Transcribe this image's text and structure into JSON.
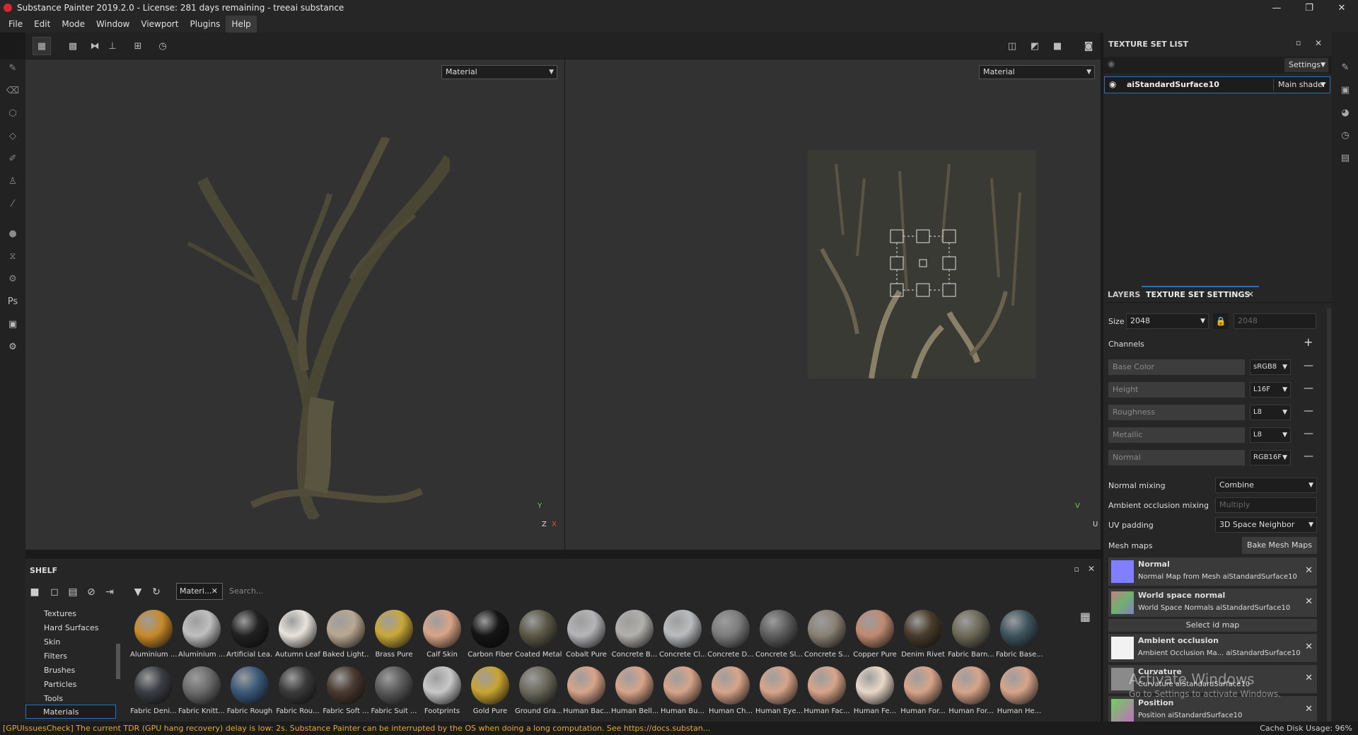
{
  "window": {
    "title": "Substance Painter 2019.2.0 - License: 281 days remaining - treeai substance",
    "minimize": "—",
    "maximize": "❐",
    "close": "✕"
  },
  "menu": [
    "File",
    "Edit",
    "Mode",
    "Window",
    "Viewport",
    "Plugins",
    "Help"
  ],
  "viewport_3d": {
    "mode": "Material",
    "axis_y": "Y",
    "axis_z": "Z",
    "axis_x": "X"
  },
  "viewport_2d": {
    "mode": "Material",
    "axis_v": "V",
    "axis_u": "U"
  },
  "texture_set_list": {
    "title": "TEXTURE SET LIST",
    "settings_label": "Settings",
    "item_name": "aiStandardSurface10",
    "shader": "Main shader"
  },
  "tabs": {
    "layers": "LAYERS",
    "texture_set_settings": "TEXTURE SET SETTINGS"
  },
  "settings": {
    "size_label": "Size",
    "size_value": "2048",
    "size_linked": "2048",
    "channels_label": "Channels",
    "channels": [
      {
        "name": "Base Color",
        "format": "sRGB8"
      },
      {
        "name": "Height",
        "format": "L16F"
      },
      {
        "name": "Roughness",
        "format": "L8"
      },
      {
        "name": "Metallic",
        "format": "L8"
      },
      {
        "name": "Normal",
        "format": "RGB16F"
      }
    ],
    "normal_mixing_label": "Normal mixing",
    "normal_mixing": "Combine",
    "ao_mixing_label": "Ambient occlusion mixing",
    "ao_mixing": "Multiply",
    "uv_padding_label": "UV padding",
    "uv_padding": "3D Space Neighbor",
    "mesh_maps_label": "Mesh maps",
    "bake_button": "Bake Mesh Maps",
    "select_id_map": "Select id map",
    "mesh_maps": [
      {
        "title": "Normal",
        "subtitle": "Normal Map from Mesh aiStandardSurface10",
        "color": "#7f7fff"
      },
      {
        "title": "World space normal",
        "subtitle": "World Space Normals aiStandardSurface10",
        "color": "#6fa07a"
      },
      {
        "title": "Ambient occlusion",
        "subtitle": "Ambient Occlusion Ma... aiStandardSurface10",
        "color": "#f2f2f2"
      },
      {
        "title": "Curvature",
        "subtitle": "Curvature aiStandardSurface10",
        "color": "#8a8a8a"
      },
      {
        "title": "Position",
        "subtitle": "Position aiStandardSurface10",
        "color": "#6fcf5a"
      }
    ]
  },
  "watermark": {
    "line1": "Activate Windows",
    "line2": "Go to Settings to activate Windows."
  },
  "shelf": {
    "title": "SHELF",
    "filter_tag": "Materi...",
    "search_placeholder": "Search...",
    "categories": [
      "Textures",
      "Hard Surfaces",
      "Skin",
      "Filters",
      "Brushes",
      "Particles",
      "Tools",
      "Materials"
    ],
    "materials_row1": [
      {
        "name": "Aluminium ...",
        "color": "#c88a2a"
      },
      {
        "name": "Aluminium ...",
        "color": "#bfbfbf"
      },
      {
        "name": "Artificial Lea...",
        "color": "#222222"
      },
      {
        "name": "Autumn Leaf",
        "color": "#e8e3dc"
      },
      {
        "name": "Baked Light...",
        "color": "#b9a892"
      },
      {
        "name": "Brass Pure",
        "color": "#c9a83a"
      },
      {
        "name": "Calf Skin",
        "color": "#d9a488"
      },
      {
        "name": "Carbon Fiber",
        "color": "#151515"
      },
      {
        "name": "Coated Metal",
        "color": "#5c5848"
      },
      {
        "name": "Cobalt Pure",
        "color": "#b5b5b8"
      },
      {
        "name": "Concrete B...",
        "color": "#b2b0ac"
      },
      {
        "name": "Concrete Cl...",
        "color": "#b9bcbf"
      },
      {
        "name": "Concrete D...",
        "color": "#7c7c7c"
      },
      {
        "name": "Concrete Sl...",
        "color": "#5e5e5e"
      },
      {
        "name": "Concrete S...",
        "color": "#8a8175"
      },
      {
        "name": "Copper Pure",
        "color": "#c08a70"
      },
      {
        "name": "Denim Rivet",
        "color": "#4a3c2c"
      },
      {
        "name": "Fabric Barn...",
        "color": "#6e6a58"
      },
      {
        "name": "Fabric Base...",
        "color": "#3e545e"
      }
    ],
    "materials_row2": [
      {
        "name": "Fabric Deni...",
        "color": "#3a3e44"
      },
      {
        "name": "Fabric Knitt...",
        "color": "#6c6c6c"
      },
      {
        "name": "Fabric Rough",
        "color": "#3c5a7a"
      },
      {
        "name": "Fabric Rou...",
        "color": "#3a3a3a"
      },
      {
        "name": "Fabric Soft ...",
        "color": "#4a3a30"
      },
      {
        "name": "Fabric Suit ...",
        "color": "#5a5a5a"
      },
      {
        "name": "Footprints",
        "color": "#c8c8c8"
      },
      {
        "name": "Gold Pure",
        "color": "#c9a432"
      },
      {
        "name": "Ground Gra...",
        "color": "#6c6a5c"
      },
      {
        "name": "Human Bac...",
        "color": "#d7a48a"
      },
      {
        "name": "Human Bell...",
        "color": "#d7a48a"
      },
      {
        "name": "Human Bu...",
        "color": "#d7a48a"
      },
      {
        "name": "Human Ch...",
        "color": "#d7a48a"
      },
      {
        "name": "Human Eye...",
        "color": "#d7a48a"
      },
      {
        "name": "Human Fac...",
        "color": "#d7a48a"
      },
      {
        "name": "Human Fe...",
        "color": "#e8d8c8"
      },
      {
        "name": "Human For...",
        "color": "#d7a48a"
      },
      {
        "name": "Human For...",
        "color": "#d7a48a"
      },
      {
        "name": "Human He...",
        "color": "#d7a48a"
      }
    ]
  },
  "status": {
    "warning": "[GPUIssuesCheck] The current TDR (GPU hang recovery) delay is low: 2s. Substance Painter can be interrupted by the OS when doing a long computation. See https://docs.substan...",
    "cache_label": "Cache Disk Usage:",
    "cache_value": "96%"
  }
}
